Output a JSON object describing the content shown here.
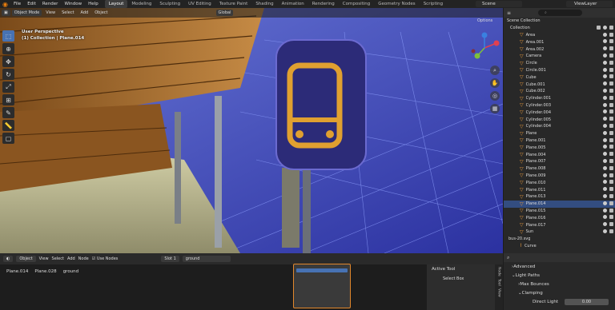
{
  "menubar": {
    "items": [
      "File",
      "Edit",
      "Render",
      "Window",
      "Help"
    ],
    "workspaces": [
      "Layout",
      "Modeling",
      "Sculpting",
      "UV Editing",
      "Texture Paint",
      "Shading",
      "Animation",
      "Rendering",
      "Compositing",
      "Geometry Nodes",
      "Scripting"
    ],
    "active_workspace": "Layout",
    "scene": "Scene",
    "view_layer": "ViewLayer"
  },
  "viewport": {
    "mode": "Object Mode",
    "menus": [
      "View",
      "Select",
      "Add",
      "Object"
    ],
    "orientation": "Global",
    "options": "Options",
    "perspective": "User Perspective",
    "collection_info": "(1) Collection | Plane.014"
  },
  "outliner": {
    "search_placeholder": "",
    "scene_collection": "Scene Collection",
    "collection": "Collection",
    "items": [
      "Area",
      "Area.001",
      "Area.002",
      "Camera",
      "Circle",
      "Circle.001",
      "Cube",
      "Cube.001",
      "Cube.002",
      "Cylinder.001",
      "Cylinder.003",
      "Cylinder.004",
      "Cylinder.005",
      "Cylinder.004",
      "Plane",
      "Plane.001",
      "Plane.005",
      "Plane.004",
      "Plane.007",
      "Plane.008",
      "Plane.009",
      "Plane.010",
      "Plane.011",
      "Plane.013",
      "Plane.014",
      "Plane.015",
      "Plane.016",
      "Plane.017",
      "Sun"
    ],
    "selected": "Plane.014",
    "extra1": "bus-20.svg",
    "extra2": "Curve"
  },
  "node_editor": {
    "mode": "Object",
    "menus": [
      "View",
      "Select",
      "Add",
      "Node"
    ],
    "use_nodes": "Use Nodes",
    "slot": "Slot 1",
    "material": "ground",
    "breadcrumb": [
      "Plane.014",
      "Plane.028",
      "ground"
    ]
  },
  "tool_panel": {
    "title": "Active Tool",
    "tool": "Select Box",
    "tabs": [
      "Node",
      "Tool",
      "View"
    ]
  },
  "properties": {
    "advanced": "Advanced",
    "light_paths": "Light Paths",
    "max_bounces": "Max Bounces",
    "clamping": "Clamping",
    "direct_light": "Direct Light",
    "direct_light_value": "0.00"
  }
}
